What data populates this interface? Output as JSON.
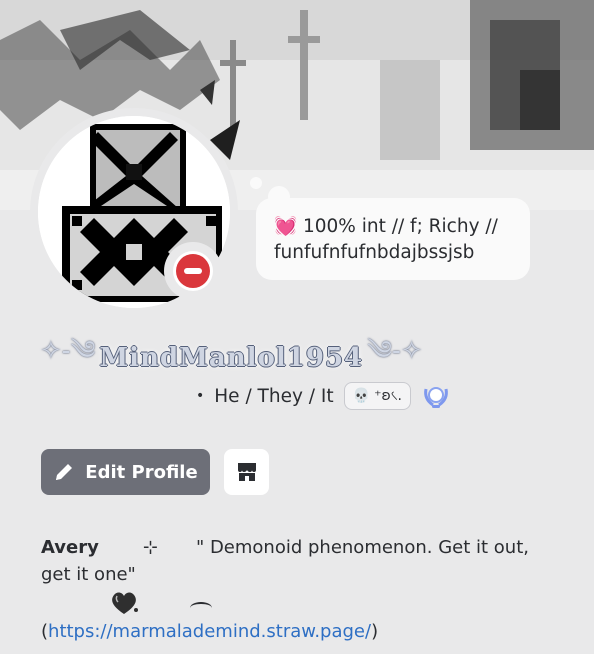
{
  "profile": {
    "display_name": "MindManlol1954",
    "name_left_deco": "✧-༄",
    "name_right_deco": "༄-✧",
    "status": "do-not-disturb",
    "status_color": "#da373c",
    "custom_status_emoji": "💓",
    "custom_status_text": "100% int // f; Richy // funfufnfufnbdajbssjsb",
    "pronouns": "He / They / It",
    "tag_emoji": "💀",
    "tag_text": "⁺ʚ৻.",
    "edit_profile_label": "Edit Profile",
    "bio": {
      "name": "Avery",
      "sep_symbol": "⊹",
      "quote": "\" Demonoid phenomenon. Get it out, get it one\"",
      "link_open": "(",
      "link": "https://marmalademind.straw.page/",
      "link_close": ")"
    }
  },
  "colors": {
    "accent_button": "#6d6f78",
    "link": "#2e6fc4",
    "background": "#e9e9ea"
  }
}
